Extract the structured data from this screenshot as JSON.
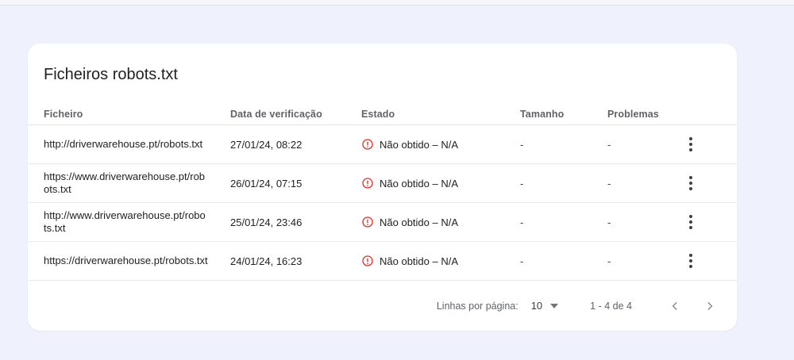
{
  "colors": {
    "background": "#eff2fc",
    "card": "#ffffff",
    "error_red": "#d93025",
    "header_text": "#5f6368",
    "body_text": "#202124"
  },
  "card": {
    "title": "Ficheiros robots.txt",
    "table": {
      "columns": {
        "file": "Ficheiro",
        "date": "Data de verificação",
        "status": "Estado",
        "size": "Tamanho",
        "issues": "Problemas"
      },
      "rows": [
        {
          "file": "http://driverwarehouse.pt/robots.txt",
          "date": "27/01/24, 08:22",
          "status": "Não obtido – N/A",
          "size": "-",
          "issues": "-"
        },
        {
          "file": "https://www.driverwarehouse.pt/robots.txt",
          "date": "26/01/24, 07:15",
          "status": "Não obtido – N/A",
          "size": "-",
          "issues": "-"
        },
        {
          "file": "http://www.driverwarehouse.pt/robots.txt",
          "date": "25/01/24, 23:46",
          "status": "Não obtido – N/A",
          "size": "-",
          "issues": "-"
        },
        {
          "file": "https://driverwarehouse.pt/robots.txt",
          "date": "24/01/24, 16:23",
          "status": "Não obtido – N/A",
          "size": "-",
          "issues": "-"
        }
      ]
    },
    "pagination": {
      "rows_per_page_label": "Linhas por página:",
      "rows_per_page_value": "10",
      "range_label": "1 - 4 de 4"
    }
  },
  "icons": {
    "status": "error-outline-icon",
    "row_menu": "kebab-menu-icon",
    "rows_per_page": "dropdown-arrow-icon",
    "prev": "chevron-left-icon",
    "next": "chevron-right-icon"
  }
}
